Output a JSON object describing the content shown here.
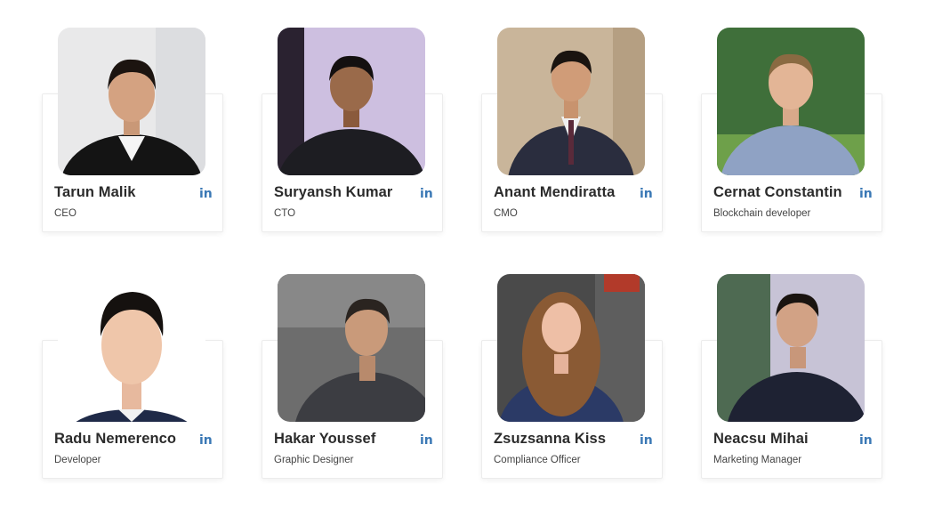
{
  "linkedin_color": "#3a78b5",
  "team": [
    {
      "name": "Tarun Malik",
      "role": "CEO",
      "linkedin_label": "in",
      "photo_icon": "person-photo-icon"
    },
    {
      "name": "Suryansh Kumar",
      "role": "CTO",
      "linkedin_label": "in",
      "photo_icon": "person-photo-icon"
    },
    {
      "name": "Anant Mendiratta",
      "role": "CMO",
      "linkedin_label": "in",
      "photo_icon": "person-photo-icon"
    },
    {
      "name": "Cernat Constantin",
      "role": "Blockchain developer",
      "linkedin_label": "in",
      "photo_icon": "person-photo-icon"
    },
    {
      "name": "Radu Nemerenco",
      "role": "Developer",
      "linkedin_label": "in",
      "photo_icon": "person-photo-icon"
    },
    {
      "name": "Hakar Youssef",
      "role": "Graphic Designer",
      "linkedin_label": "in",
      "photo_icon": "person-photo-icon"
    },
    {
      "name": "Zsuzsanna Kiss",
      "role": "Compliance Officer",
      "linkedin_label": "in",
      "photo_icon": "person-photo-icon"
    },
    {
      "name": "Neacsu Mihai",
      "role": "Marketing Manager",
      "linkedin_label": "in",
      "photo_icon": "person-photo-icon"
    }
  ]
}
